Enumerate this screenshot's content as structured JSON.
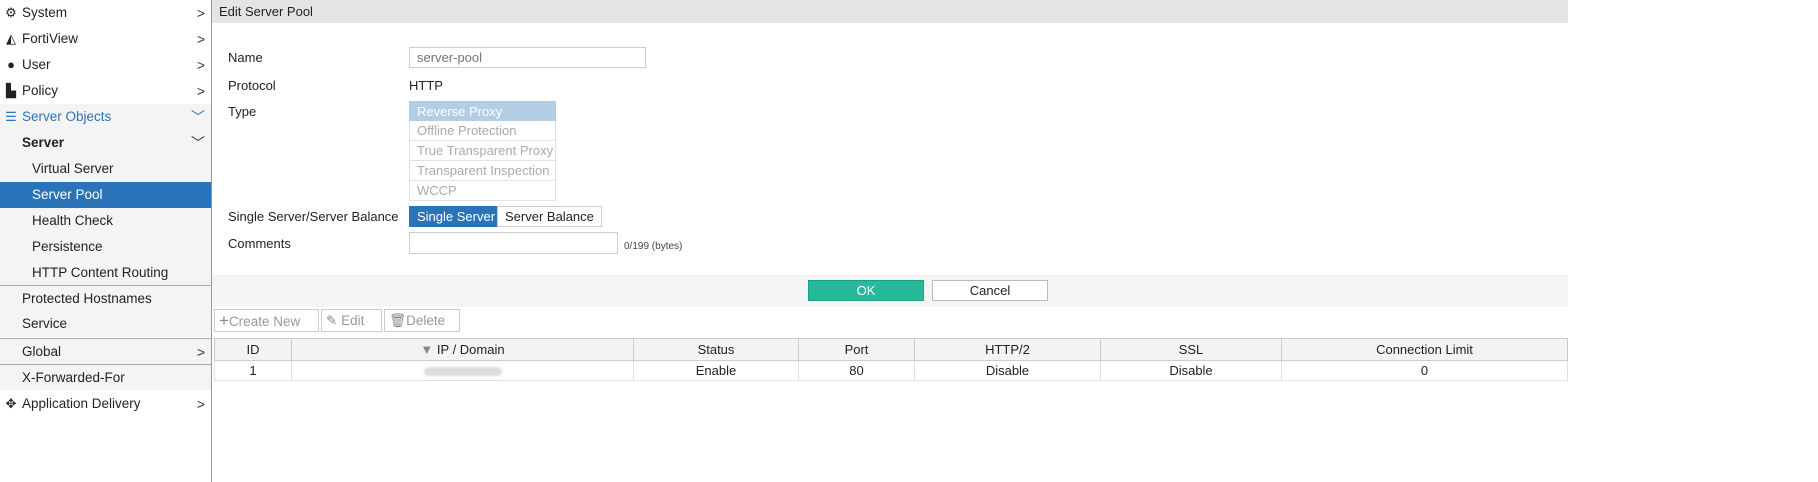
{
  "sidebar": {
    "items": [
      {
        "label": "System",
        "icon": "gear-icon"
      },
      {
        "label": "FortiView",
        "icon": "chart-icon"
      },
      {
        "label": "User",
        "icon": "user-icon"
      },
      {
        "label": "Policy",
        "icon": "policy-icon"
      },
      {
        "label": "Server Objects",
        "icon": "server-icon"
      },
      {
        "label": "Server"
      },
      {
        "label": "Virtual Server"
      },
      {
        "label": "Server Pool"
      },
      {
        "label": "Health Check"
      },
      {
        "label": "Persistence"
      },
      {
        "label": "HTTP Content Routing"
      },
      {
        "label": "Protected Hostnames"
      },
      {
        "label": "Service"
      },
      {
        "label": "Global"
      },
      {
        "label": "X-Forwarded-For"
      },
      {
        "label": "Application Delivery",
        "icon": "move-icon"
      }
    ]
  },
  "header": {
    "title": "Edit Server Pool"
  },
  "form": {
    "name_label": "Name",
    "name_value": "server-pool",
    "protocol_label": "Protocol",
    "protocol_value": "HTTP",
    "type_label": "Type",
    "type_options": [
      "Reverse Proxy",
      "Offline Protection",
      "True Transparent Proxy",
      "Transparent Inspection",
      "WCCP"
    ],
    "type_selected": "Reverse Proxy",
    "balance_label": "Single Server/Server Balance",
    "balance_options": [
      "Single Server",
      "Server Balance"
    ],
    "balance_selected": "Single Server",
    "comments_label": "Comments",
    "comments_value": "",
    "comments_counter": "0/199 (bytes)"
  },
  "actions": {
    "ok": "OK",
    "cancel": "Cancel"
  },
  "toolbar": {
    "create": "Create New",
    "edit": "Edit",
    "delete": "Delete"
  },
  "table": {
    "columns": [
      "ID",
      "IP / Domain",
      "Status",
      "Port",
      "HTTP/2",
      "SSL",
      "Connection Limit"
    ],
    "rows": [
      {
        "id": "1",
        "ip": "",
        "status": "Enable",
        "port": "80",
        "http2": "Disable",
        "ssl": "Disable",
        "limit": "0"
      }
    ]
  },
  "colors": {
    "accent": "#2a73b8",
    "ok": "#26b99a",
    "selected_type": "#b3cde4"
  }
}
